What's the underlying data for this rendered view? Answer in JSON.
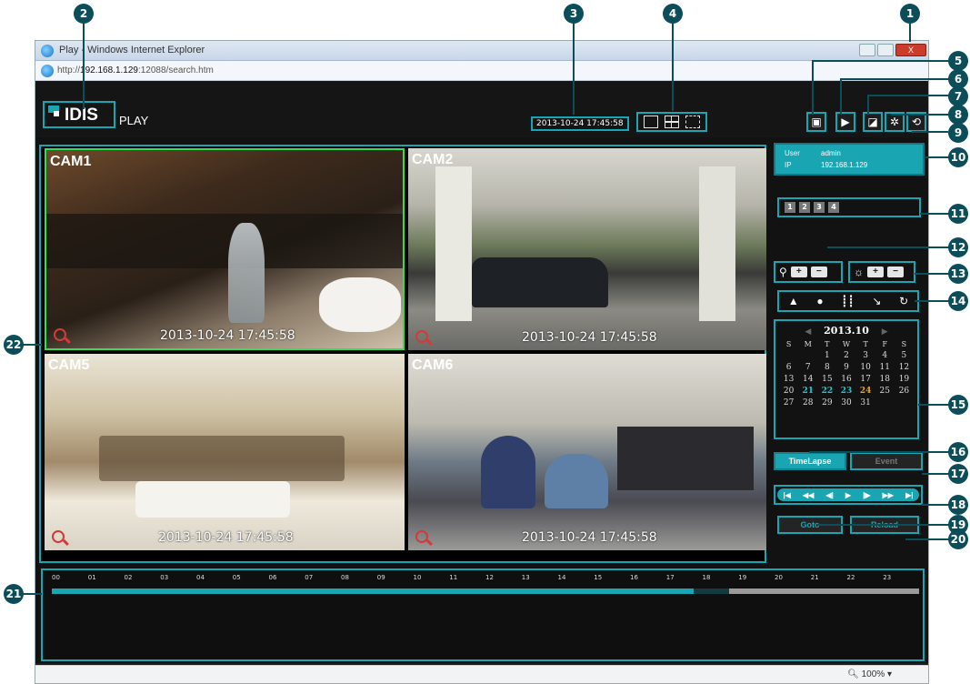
{
  "browser": {
    "title": "Play - Windows Internet Explorer",
    "url_prefix": "http://",
    "url_host": "192.168.1.129",
    "url_rest": ":12088/search.htm",
    "close_label": "X",
    "zoom": "100%"
  },
  "header": {
    "logo": "IDIS",
    "product": "PLAY",
    "datetime": "2013-10-24 17:45:58"
  },
  "cameras": [
    {
      "label": "CAM1",
      "timestamp": "2013-10-24 17:45:58"
    },
    {
      "label": "CAM2",
      "timestamp": "2013-10-24 17:45:58"
    },
    {
      "label": "CAM5",
      "timestamp": "2013-10-24 17:45:58"
    },
    {
      "label": "CAM6",
      "timestamp": "2013-10-24 17:45:58"
    }
  ],
  "user_panel": {
    "user_key": "User",
    "user_value": "admin",
    "ip_key": "IP",
    "ip_value": "192.168.1.129"
  },
  "pages": [
    "1",
    "2",
    "3",
    "4"
  ],
  "controls": {
    "plus": "+",
    "minus": "−"
  },
  "calendar": {
    "month": "2013.10",
    "prev": "◀",
    "next": "▶",
    "weekdays": [
      "S",
      "M",
      "T",
      "W",
      "T",
      "F",
      "S"
    ],
    "days": [
      "",
      "",
      "1",
      "2",
      "3",
      "4",
      "5",
      "6",
      "7",
      "8",
      "9",
      "10",
      "11",
      "12",
      "13",
      "14",
      "15",
      "16",
      "17",
      "18",
      "19",
      "20",
      "21",
      "22",
      "23",
      "24",
      "25",
      "26",
      "27",
      "28",
      "29",
      "30",
      "31",
      "",
      ""
    ],
    "recorded_days": [
      "21",
      "22",
      "23"
    ],
    "selected_day": "24"
  },
  "tabs": {
    "timelapse": "TimeLapse",
    "event": "Event"
  },
  "playback": [
    "|◀",
    "◀◀",
    "◀|",
    "▶",
    "|▶",
    "▶▶",
    "▶|"
  ],
  "buttons": {
    "goto": "Goto",
    "reload": "Reload"
  },
  "timeline": {
    "hours": [
      "00",
      "01",
      "02",
      "03",
      "04",
      "05",
      "06",
      "07",
      "08",
      "09",
      "10",
      "11",
      "12",
      "13",
      "14",
      "15",
      "16",
      "17",
      "18",
      "19",
      "20",
      "21",
      "22",
      "23"
    ],
    "recorded_until_hour": 17.75,
    "current_hour_start": 17.0,
    "current_hour_end": 18.0
  },
  "callouts": [
    "1",
    "2",
    "3",
    "4",
    "5",
    "6",
    "7",
    "8",
    "9",
    "10",
    "11",
    "12",
    "13",
    "14",
    "15",
    "16",
    "17",
    "18",
    "19",
    "20",
    "21",
    "22"
  ],
  "colors": {
    "accent": "#1aa5b3",
    "callout": "#0b4e5a",
    "recorded_day": "#1fc6d6",
    "selected_day": "#f0a21a",
    "active_camera_border": "#33dd55"
  }
}
